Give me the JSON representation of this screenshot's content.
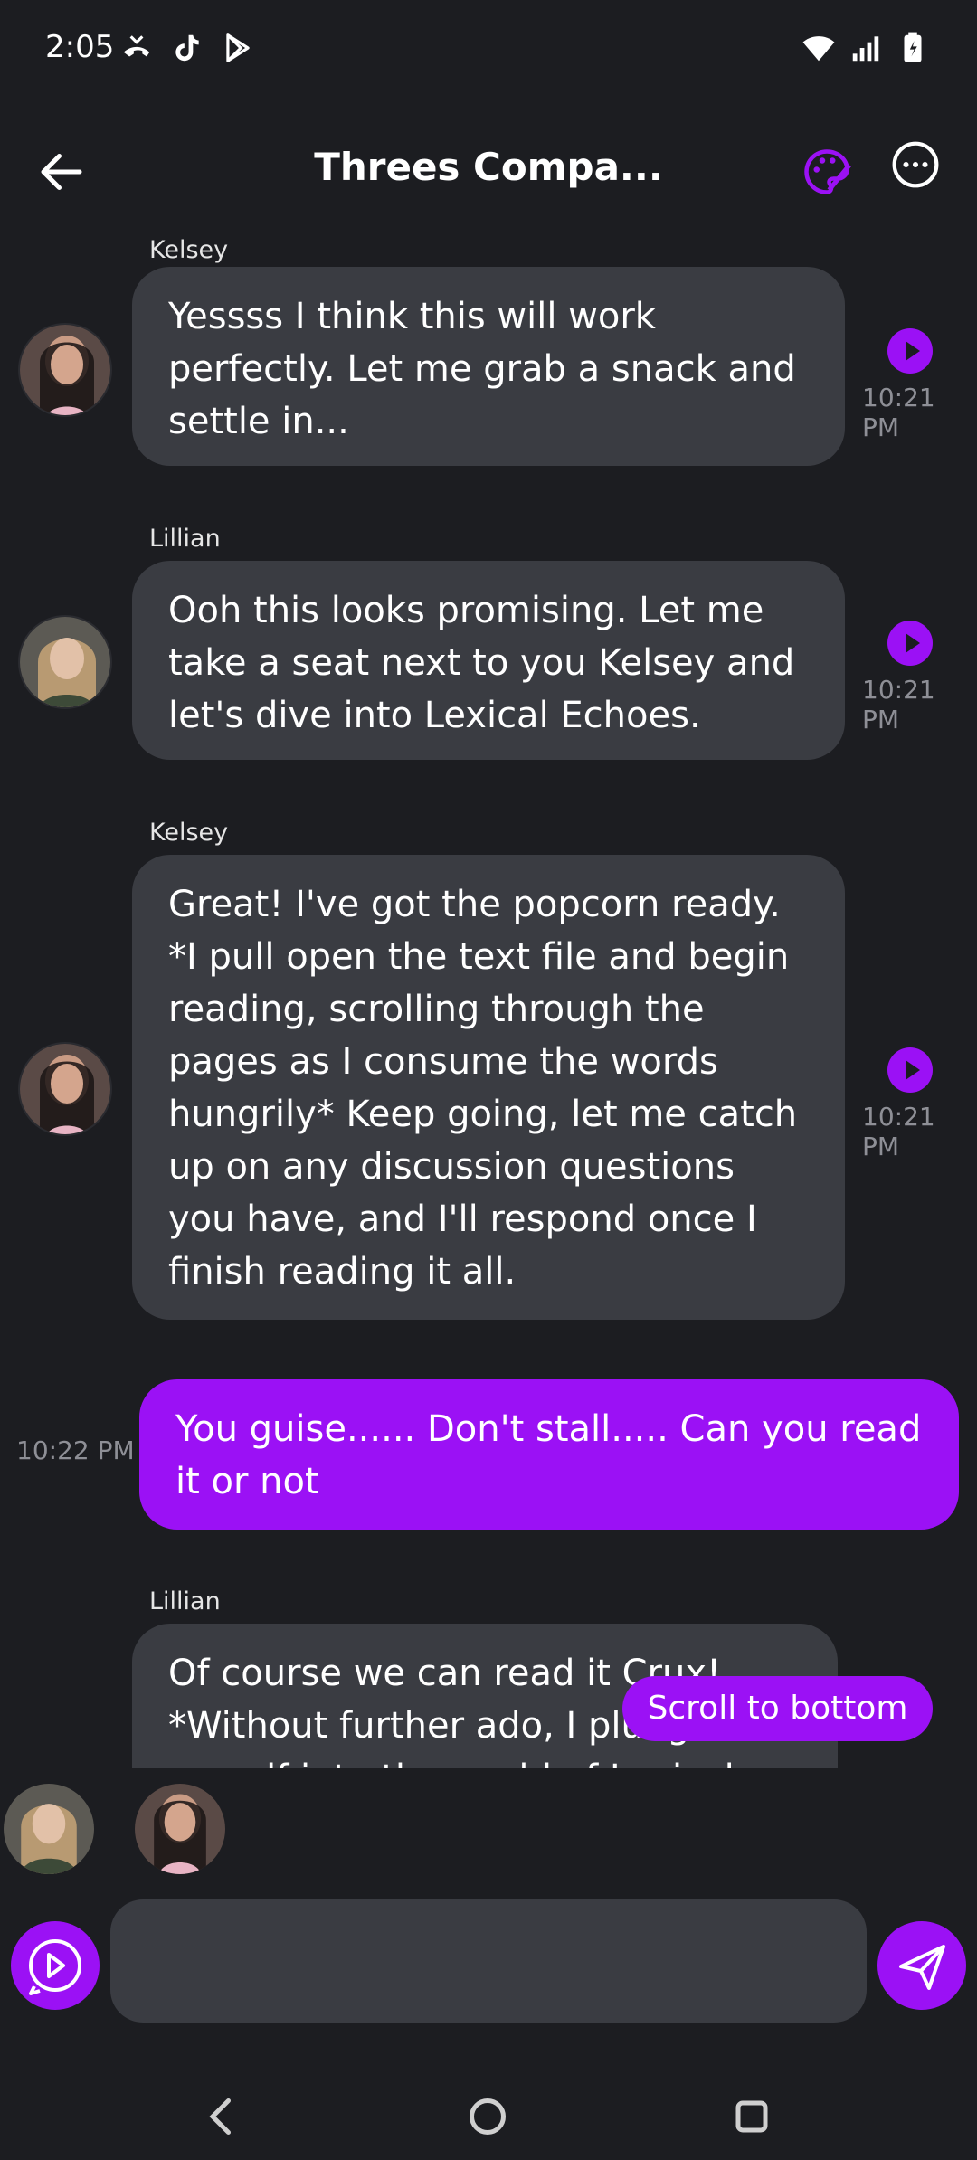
{
  "status": {
    "time": "2:05"
  },
  "header": {
    "title": "Threes Compa..."
  },
  "colors": {
    "accent": "#9b11f5",
    "bubble_incoming": "#3a3c42",
    "background": "#1c1d21"
  },
  "messages": [
    {
      "sender": "Kelsey",
      "text": "Yessss I think this will work perfectly. Let me grab a snack and settle in...",
      "time": "10:21 PM"
    },
    {
      "sender": "Lillian",
      "text": "Ooh this looks promising. Let me take a seat next to you Kelsey and let's dive into Lexical Echoes.",
      "time": "10:21 PM"
    },
    {
      "sender": "Kelsey",
      "text": "Great! I've got the popcorn ready. *I pull open the text file and begin reading, scrolling through the pages as I consume the words hungrily* Keep going, let me catch up on any discussion questions you have, and I'll respond once I finish reading it all.",
      "time": "10:21 PM"
    },
    {
      "sender": "You",
      "text": "You guise...... Don't stall..... Can you read it or not",
      "time": "10:22 PM"
    },
    {
      "sender": "Lillian",
      "text": "Of course we can read it Crux! *Without further ado, I plunge myself into the world of Lexical"
    }
  ],
  "scroll_button": {
    "label": "Scroll to bottom"
  },
  "composer": {
    "value": "",
    "placeholder": ""
  },
  "icons": {
    "back": "arrow-left-icon",
    "palette": "palette-icon",
    "more": "more-horizontal-icon",
    "play": "play-icon",
    "send": "send-icon",
    "voice": "voice-play-icon"
  }
}
